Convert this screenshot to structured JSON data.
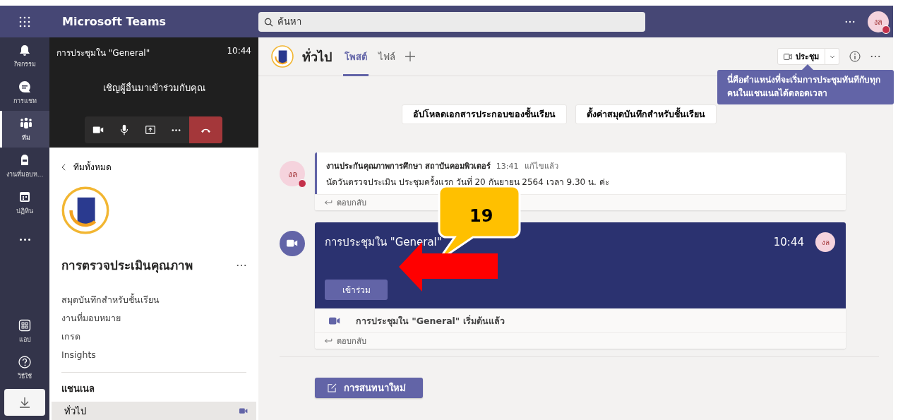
{
  "top_bar": {
    "title": "Microsoft Teams",
    "search": {
      "placeholder": "ค้นหา"
    },
    "avatar": "งล",
    "busy": true
  },
  "rail": {
    "items": [
      {
        "kind": "bell",
        "label": "กิจกรรม",
        "selected": false
      },
      {
        "kind": "chat",
        "label": "การแชท",
        "selected": false
      },
      {
        "kind": "team",
        "label": "ทีม",
        "selected": true
      },
      {
        "kind": "bag",
        "label": "งานที่มอบห...",
        "selected": false
      },
      {
        "kind": "calendar",
        "label": "ปฏิทิน",
        "selected": false
      },
      {
        "kind": "more",
        "selected": false
      }
    ],
    "bottom_items": [
      {
        "kind": "apps",
        "label": "แอป"
      },
      {
        "kind": "help",
        "label": "วิธีใช้"
      },
      {
        "kind": "download"
      }
    ]
  },
  "meeting_panel": {
    "title": "การประชุมใน \"General\"",
    "time": "10:44",
    "invite_text": "เชิญผู้อื่นมาเข้าร่วมกับคุณ",
    "controls": [
      {
        "kind": "camera"
      },
      {
        "kind": "mic"
      },
      {
        "kind": "share"
      },
      {
        "kind": "more"
      },
      {
        "kind": "hangup"
      }
    ]
  },
  "team": {
    "back_label": "ทีมทั้งหมด",
    "name": "การตรวจประเมินคุณภาพ",
    "items": [
      "สมุดบันทึกสำหรับชั้นเรียน",
      "งานที่มอบหมาย",
      "เกรด",
      "Insights"
    ],
    "channels_heading": "แชนเนล",
    "channels": [
      {
        "name": "ทั่วไป",
        "selected": true,
        "in_meeting": true
      }
    ]
  },
  "channel_header": {
    "name": "ทั่วไป",
    "tabs": [
      {
        "label": "โพสต์",
        "selected": true
      },
      {
        "label": "ไฟล์",
        "selected": false
      }
    ],
    "meet_button": "ประชุม"
  },
  "tooltip": "นี่คือตำแหน่งที่จะเริ่มการประชุมทันทีกับทุกคนในแชนเนลได้ตลอดเวลา",
  "pinned_buttons": [
    "อัปโหลดเอกสารประกอบของชั้นเรียน",
    "ตั้งค่าสมุดบันทึกสำหรับชั้นเรียน"
  ],
  "messages": [
    {
      "kind": "post",
      "avatar": "งล",
      "busy": true,
      "author": "งานประกันคุณภาพการศึกษา สถาบันคอมพิวเตอร์",
      "time": "13:41",
      "edited": "แก้ไขแล้ว",
      "text": "นัดวันตรวจประเมิน ประชุมครั้งแรก วันที่ 20 กันยายน 2564 เวลา 9.30 น. ค่ะ",
      "reply": "ตอบกลับ"
    },
    {
      "kind": "meeting",
      "title": "การประชุมใน \"General\"",
      "time": "10:44",
      "avatar": "งล",
      "join": "เข้าร่วม",
      "event": "การประชุมใน \"General\" เริ่มต้นแล้ว",
      "reply": "ตอบกลับ"
    }
  ],
  "new_conversation": "การสนทนาใหม่",
  "callout": {
    "number": "19"
  }
}
